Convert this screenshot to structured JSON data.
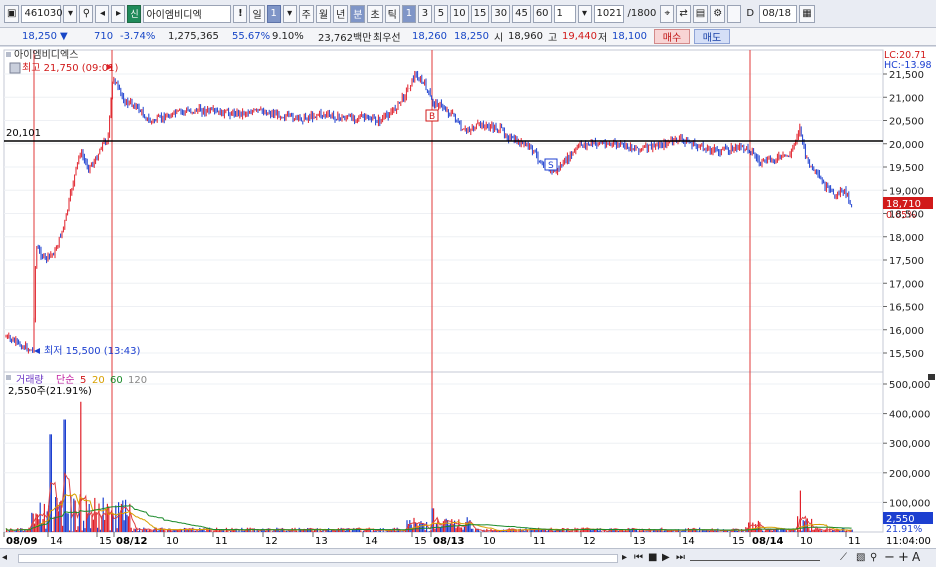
{
  "toolbar": {
    "code": "461030",
    "stock_badge": "신",
    "stock_name": "아이엠비디엑",
    "warn": "!",
    "periods": [
      "일",
      "1",
      "주",
      "월",
      "년",
      "분",
      "초",
      "틱"
    ],
    "active_period": "분",
    "minutes": [
      "1",
      "3",
      "5",
      "10",
      "15",
      "30",
      "45",
      "60"
    ],
    "count_select": "1",
    "count_display": "1021",
    "count_total": "/1800",
    "date": "08/18"
  },
  "info": {
    "price": "18,250",
    "change_arrow": "▼",
    "change": "710",
    "change_pct": "-3.74%",
    "volume": "1,275,365",
    "vol_ratio": "55.67%",
    "turnover": "9.10%",
    "amount": "23,762백만",
    "best_label": "최우선",
    "best_ask": "18,260",
    "best_bid": "18,250",
    "open_label": "시",
    "open": "18,960",
    "high_label": "고",
    "high": "19,440",
    "low_label": "저",
    "low": "18,100",
    "buy_label": "매수",
    "sell_label": "매도"
  },
  "price_panel": {
    "title": "아이엠비디엑스",
    "high_label": "최고 21,750 (09:01)",
    "low_label": "최저 15,500 (13:43)",
    "hline_label": "20,101",
    "lc": "LC:20.71",
    "hc": "HC:-13.98",
    "current_price": "18,710",
    "current_pct": "0.05%",
    "buy_marker": "B",
    "sell_marker": "S",
    "yticks": [
      "21,500",
      "21,000",
      "20,500",
      "20,000",
      "19,500",
      "19,000",
      "18,500",
      "18,000",
      "17,500",
      "17,000",
      "16,500",
      "16,000",
      "15,500"
    ]
  },
  "volume_panel": {
    "legend_main": "거래량",
    "legend_ma": "단순",
    "legend_5": "5",
    "legend_20": "20",
    "legend_60": "60",
    "legend_120": "120",
    "value_label": "2,550주(21.91%)",
    "current_vol": "2,550",
    "current_pct": "21.91%",
    "yticks": [
      "500,000",
      "400,000",
      "300,000",
      "200,000",
      "100,000"
    ]
  },
  "xaxis": {
    "labels": [
      "08/09",
      "14",
      "15",
      "08/12",
      "10",
      "11",
      "12",
      "13",
      "14",
      "15",
      "08/13",
      "10",
      "11",
      "12",
      "13",
      "14",
      "15",
      "08/14",
      "10",
      "11"
    ],
    "time": "11:04:00"
  },
  "colors": {
    "up": "#e0202a",
    "down": "#1c3fd0",
    "accent": "#7f95c7",
    "bg": "#ffffff"
  }
}
